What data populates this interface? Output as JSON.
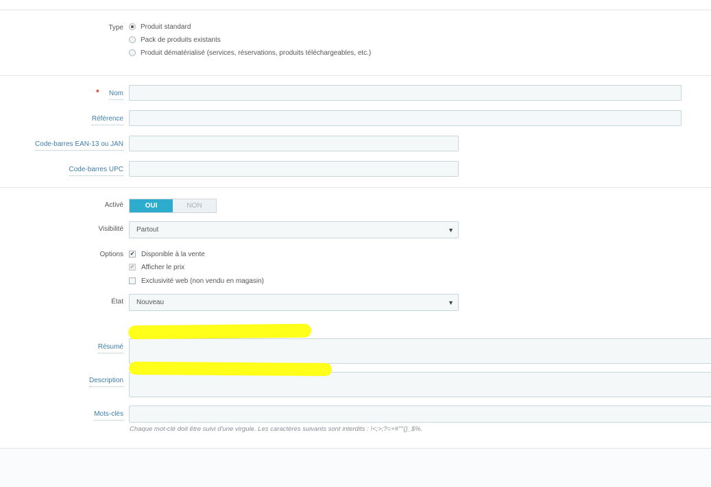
{
  "type_section": {
    "label": "Type",
    "options": [
      {
        "label": "Produit standard",
        "selected": true
      },
      {
        "label": "Pack de produits existants",
        "selected": false
      },
      {
        "label": "Produit dématérialisé (services, réservations, produits téléchargeables, etc.)",
        "selected": false
      }
    ]
  },
  "identity": {
    "required_marker": "*",
    "name_label": "Nom",
    "name_value": "",
    "reference_label": "Référence",
    "reference_value": "",
    "ean13_label": "Code-barres EAN-13 ou JAN",
    "ean13_value": "",
    "upc_label": "Code-barres UPC",
    "upc_value": ""
  },
  "status": {
    "active_label": "Activé",
    "toggle_on": "OUI",
    "toggle_off": "NON",
    "active": true,
    "visibility_label": "Visibilité",
    "visibility_value": "Partout",
    "options_label": "Options",
    "options": [
      {
        "label": "Disponible à la vente",
        "checked": true,
        "disabled": false
      },
      {
        "label": "Afficher le prix",
        "checked": true,
        "disabled": true
      },
      {
        "label": "Exclusivité web (non vendu en magasin)",
        "checked": false,
        "disabled": false
      }
    ],
    "condition_label": "État",
    "condition_value": "Nouveau"
  },
  "content": {
    "summary_label": "Résumé",
    "summary_value": "",
    "description_label": "Description",
    "description_value": "",
    "keywords_label": "Mots-clés",
    "keywords_value": "",
    "keywords_help": "Chaque mot-clé doit être suivi d'une virgule. Les caractères suivants sont interdits : !<;>;?=+#\"°{}_$%."
  },
  "colors": {
    "toggle_active": "#2eacce",
    "required": "#d9362f",
    "hint_label": "#3d7ea6",
    "highlight": "#ffff1a"
  }
}
